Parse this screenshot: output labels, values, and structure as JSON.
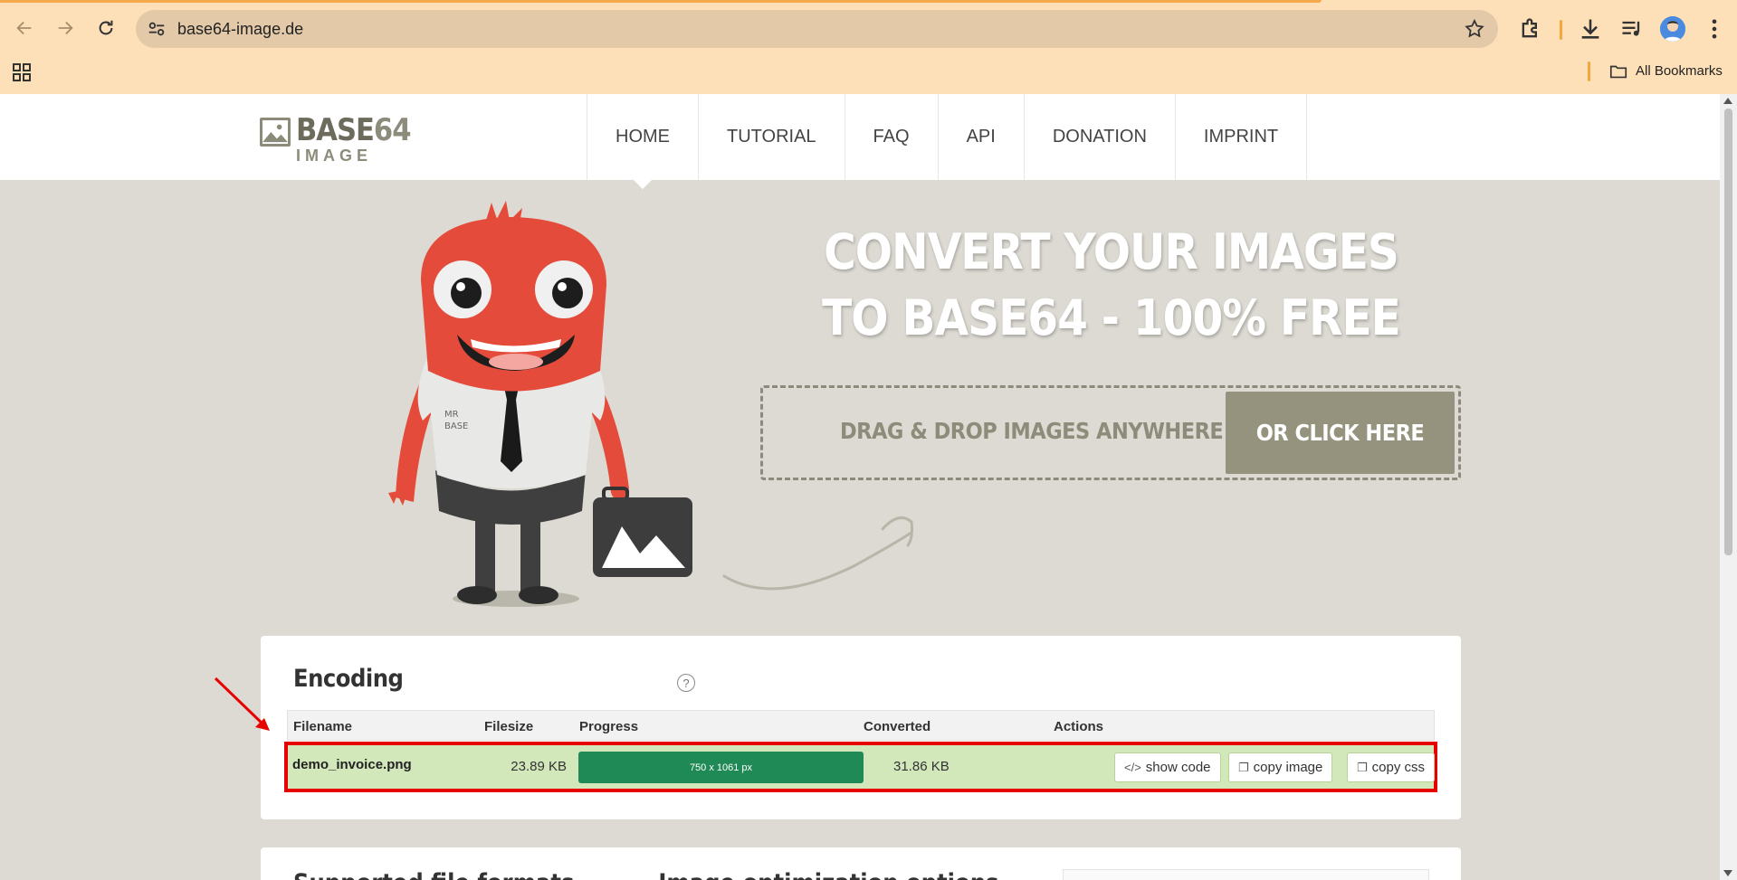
{
  "browser": {
    "url": "base64-image.de",
    "bookmarks_label": "All Bookmarks",
    "accent_color": "#f6a94a"
  },
  "site": {
    "logo_main": "BASE",
    "logo_num": "64",
    "logo_sub": "IMAGE",
    "nav": [
      {
        "label": "HOME",
        "active": true
      },
      {
        "label": "TUTORIAL"
      },
      {
        "label": "FAQ"
      },
      {
        "label": "API"
      },
      {
        "label": "DONATION"
      },
      {
        "label": "IMPRINT"
      }
    ]
  },
  "hero": {
    "title_line1": "CONVERT YOUR IMAGES",
    "title_line2": "TO BASE64 - 100% FREE",
    "drop_text": "DRAG & DROP IMAGES ANYWHERE",
    "click_label": "OR CLICK HERE",
    "mascot_shirt_text1": "MR",
    "mascot_shirt_text2": "BASE"
  },
  "encoding": {
    "title": "Encoding",
    "help": "?",
    "columns": {
      "filename": "Filename",
      "filesize": "Filesize",
      "progress": "Progress",
      "converted": "Converted",
      "actions": "Actions"
    },
    "rows": [
      {
        "filename": "demo_invoice.png",
        "filesize": "23.89 KB",
        "progress_label": "750 x 1061 px",
        "progress": 1.0,
        "converted": "31.86 KB",
        "actions": {
          "show_code": "show code",
          "copy_image": "copy image",
          "copy_css": "copy css"
        }
      }
    ],
    "row_color": "#d2e8bb",
    "progress_color": "#1f8a55",
    "highlight_color": "#e60000"
  },
  "next_section": {
    "title": "Supported file formats            Image optimization options"
  }
}
